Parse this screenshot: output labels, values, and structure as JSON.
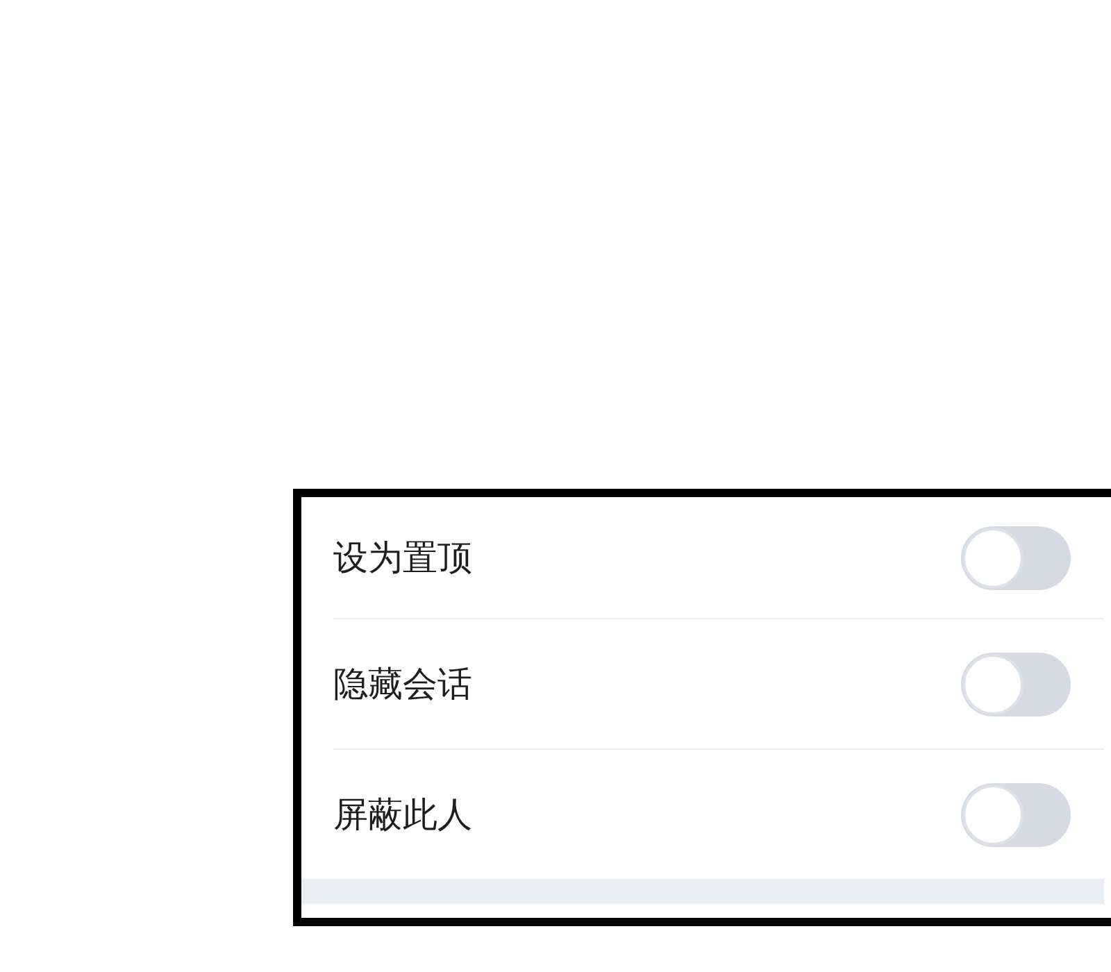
{
  "settings": [
    {
      "label": "设为置顶",
      "on": false
    },
    {
      "label": "隐藏会话",
      "on": false
    },
    {
      "label": "屏蔽此人",
      "on": false
    }
  ]
}
